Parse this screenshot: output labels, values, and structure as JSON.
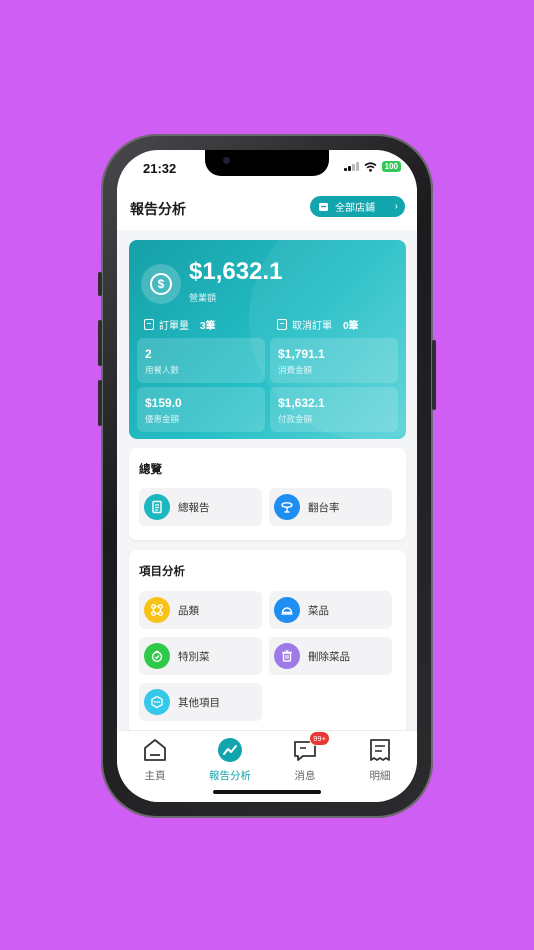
{
  "status_bar": {
    "time": "21:32",
    "battery": "100"
  },
  "header": {
    "title": "報告分析",
    "store_button": "全部店鋪"
  },
  "summary": {
    "revenue": "$1,632.1",
    "revenue_label": "營業額",
    "orders_label": "訂單量",
    "orders_value": "3筆",
    "cancelled_label": "取消訂單",
    "cancelled_value": "0筆",
    "tiles": [
      {
        "value": "2",
        "label": "用餐人數"
      },
      {
        "value": "$1,791.1",
        "label": "消費金額"
      },
      {
        "value": "$159.0",
        "label": "優惠金額"
      },
      {
        "value": "$1,632.1",
        "label": "付款金額"
      }
    ]
  },
  "overview": {
    "title": "總覽",
    "items": [
      {
        "label": "總報告",
        "icon": "report-icon"
      },
      {
        "label": "翻台率",
        "icon": "table-icon"
      }
    ]
  },
  "item_analysis": {
    "title": "項目分析",
    "items": [
      {
        "label": "品類",
        "icon": "category-icon"
      },
      {
        "label": "菜品",
        "icon": "dish-icon"
      },
      {
        "label": "特別菜",
        "icon": "special-icon"
      },
      {
        "label": "刪除菜品",
        "icon": "trash-icon"
      },
      {
        "label": "其他項目",
        "icon": "more-icon"
      }
    ]
  },
  "tabbar": {
    "tabs": [
      {
        "label": "主頁",
        "icon": "home-icon"
      },
      {
        "label": "報告分析",
        "icon": "chart-icon"
      },
      {
        "label": "消息",
        "icon": "message-icon"
      },
      {
        "label": "明細",
        "icon": "receipt-icon"
      }
    ],
    "message_badge": "99+"
  },
  "colors": {
    "background": "#cf5ff4",
    "accent": "#13a5ad",
    "badge": "#e53935"
  }
}
